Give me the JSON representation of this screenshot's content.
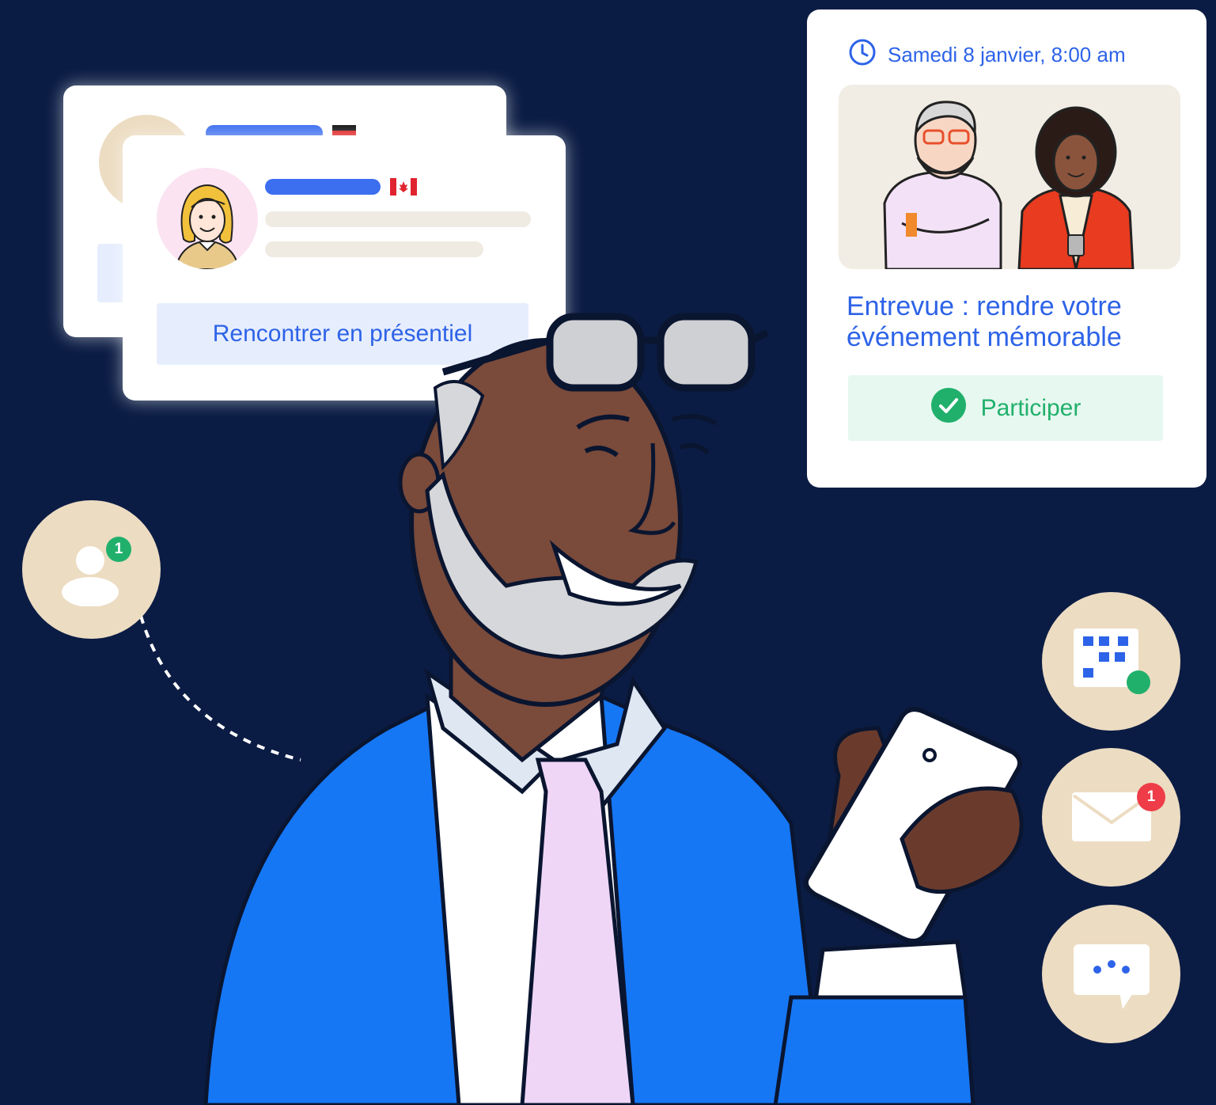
{
  "profile_card": {
    "meet_button_label": "Rencontrer en présentiel",
    "flag": "canada-flag-icon"
  },
  "event_card": {
    "date": "Samedi 8 janvier, 8:00 am",
    "title_line1": "Entrevue : rendre votre",
    "title_line2": "événement mémorable",
    "join_button_label": "Participer"
  },
  "notifications": {
    "contacts_count": "1",
    "mail_count": "1"
  },
  "colors": {
    "background": "#0b1c44",
    "accent_blue": "#2d63e8",
    "success_green": "#21b06c",
    "alert_red": "#ee3d48",
    "badge_beige": "#ecdcc2"
  }
}
